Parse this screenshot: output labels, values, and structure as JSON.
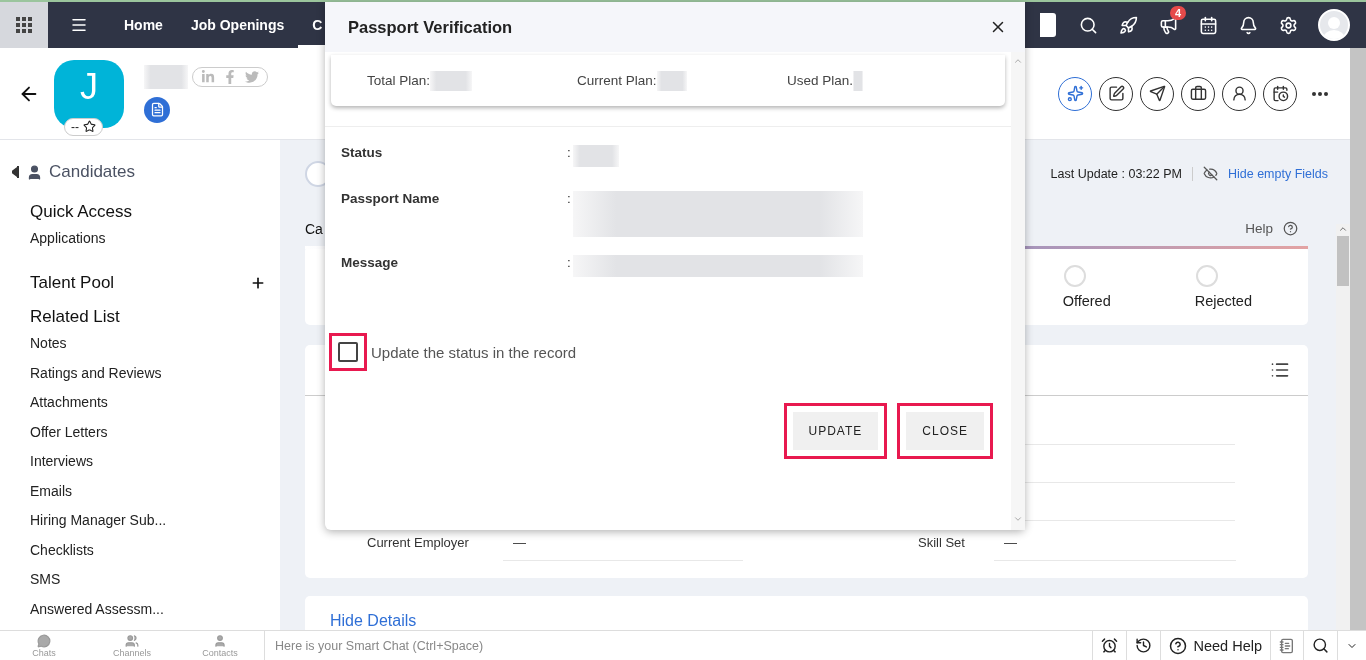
{
  "nav": {
    "items": [
      {
        "label": "Home",
        "selected": false
      },
      {
        "label": "Job Openings",
        "selected": false
      },
      {
        "label": "C",
        "selected": true
      }
    ],
    "notification_count": "4"
  },
  "record": {
    "initial": "J",
    "rating": "--"
  },
  "sidebar": {
    "module": "Candidates",
    "sections": [
      {
        "title": "Quick Access",
        "kind": "list",
        "items": [
          "Applications"
        ]
      },
      {
        "title": "Talent Pool",
        "kind": "add"
      },
      {
        "title": "Related List",
        "kind": "list",
        "items": [
          "Notes",
          "Ratings and Reviews",
          "Attachments",
          "Offer Letters",
          "Interviews",
          "Emails",
          "Hiring Manager Sub...",
          "Checklists",
          "SMS",
          "Answered Assessm..."
        ]
      }
    ]
  },
  "main": {
    "last_update": "Last Update : 03:22 PM",
    "hide_empty": "Hide empty Fields",
    "section_label": "Ca",
    "help": "Help",
    "stages": [
      {
        "label": "Offered",
        "selected": false
      },
      {
        "label": "Rejected",
        "selected": false
      }
    ],
    "fields": [
      {
        "label": "Current Employer",
        "value": "—"
      },
      {
        "label": "Skill Set",
        "value": "—"
      }
    ],
    "hide_details": "Hide Details"
  },
  "modal": {
    "title": "Passport Verification",
    "plans": [
      "Total Plan:",
      "Current Plan:",
      "Used Plan."
    ],
    "fields": [
      {
        "label": "Status",
        "colon": ":"
      },
      {
        "label": "Passport Name",
        "colon": ":"
      },
      {
        "label": "Message",
        "colon": ":"
      }
    ],
    "checkbox": {
      "label": "Update the status in the record",
      "checked": false,
      "highlighted": true
    },
    "buttons": [
      {
        "label": "UPDATE",
        "highlighted": true
      },
      {
        "label": "CLOSE",
        "highlighted": true
      }
    ]
  },
  "chat_bar": {
    "tabs": [
      "Chats",
      "Channels",
      "Contacts"
    ],
    "placeholder": "Here is your Smart Chat (Ctrl+Space)",
    "help": "Need Help"
  }
}
